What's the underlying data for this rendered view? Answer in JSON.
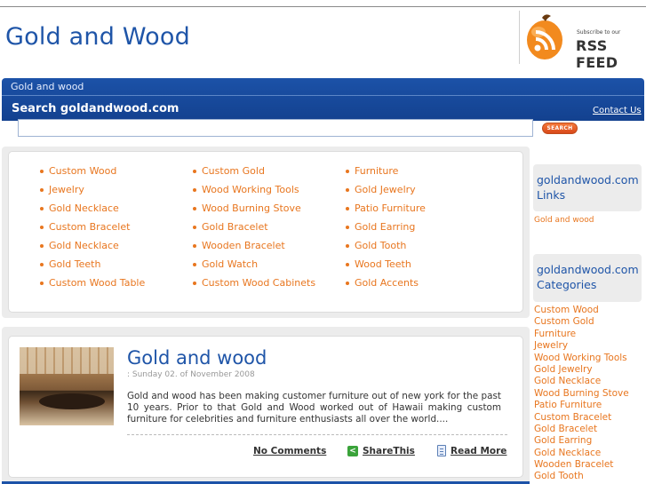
{
  "header": {
    "site_title": "Gold and Wood",
    "rss_small": "Subscribe to our",
    "rss_big": "RSS FEED"
  },
  "bluebar": {
    "subtitle": "Gold and wood",
    "search_label": "Search goldandwood.com",
    "contact_label": "Contact Us",
    "search_placeholder": "",
    "search_button": "SEARCH"
  },
  "links": {
    "col1": [
      "Custom Wood",
      "Jewelry",
      "Gold Necklace",
      "Custom Bracelet",
      "Gold Necklace",
      "Gold Teeth",
      "Custom Wood Table"
    ],
    "col2": [
      "Custom Gold",
      "Wood Working Tools",
      "Wood Burning Stove",
      "Gold Bracelet",
      "Wooden Bracelet",
      "Gold Watch",
      "Custom Wood Cabinets"
    ],
    "col3": [
      "Furniture",
      "Gold Jewelry",
      "Patio Furniture",
      "Gold Earring",
      "Gold Tooth",
      "Wood Teeth",
      "Gold Accents"
    ]
  },
  "post": {
    "title": "Gold and wood",
    "date": ": Sunday 02. of November 2008",
    "body": "Gold and wood has been making customer furniture out of new york for the past 10 years.  Prior to that Gold and Wood worked out of Hawaii making custom furniture for celebrities and furniture enthusiasts all over the world....",
    "comments": "No Comments",
    "share": "ShareThis",
    "readmore": "Read More"
  },
  "sidebar": {
    "links_heading": "goldandwood.com Links",
    "links": [
      "Gold and wood"
    ],
    "categories_heading": "goldandwood.com Categories",
    "categories": [
      "Custom Wood",
      "Custom Gold",
      "Furniture",
      "Jewelry",
      "Wood Working Tools",
      "Gold Jewelry",
      "Gold Necklace",
      "Wood Burning Stove",
      "Patio Furniture",
      "Custom Bracelet",
      "Gold Bracelet",
      "Gold Earring",
      "Gold Necklace",
      "Wooden Bracelet",
      "Gold Tooth"
    ]
  },
  "colors": {
    "brand_blue": "#1f55a8",
    "link_orange": "#e8761f",
    "rss_orange": "#f28a1e"
  },
  "icons": {
    "rss": "rss-feed-icon",
    "share": "share-icon",
    "readmore": "document-icon"
  }
}
